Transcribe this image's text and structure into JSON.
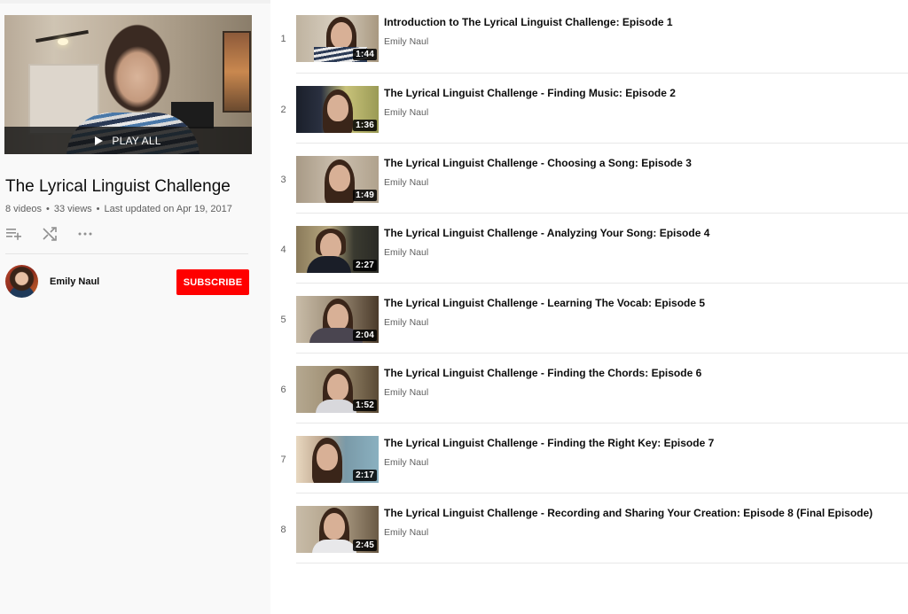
{
  "playlist": {
    "play_all_label": "PLAY ALL",
    "title": "The Lyrical Linguist Challenge",
    "stats": {
      "videos": "8 videos",
      "views": "33 views",
      "updated": "Last updated on Apr 19, 2017"
    },
    "separator": "•",
    "actions": [
      {
        "icon": "add-to-queue-icon",
        "label": "Save"
      },
      {
        "icon": "shuffle-icon",
        "label": "Shuffle"
      },
      {
        "icon": "more-icon",
        "label": "More actions"
      }
    ],
    "owner": {
      "name": "Emily Naul",
      "subscribe_label": "SUBSCRIBE"
    }
  },
  "colors": {
    "subscribe": "#ff0000",
    "sidebar_bg": "#f9f9f9",
    "secondary_text": "#606060"
  },
  "videos": [
    {
      "index": "1",
      "title": "Introduction to The Lyrical Linguist Challenge: Episode 1",
      "channel": "Emily Naul",
      "duration": "1:44"
    },
    {
      "index": "2",
      "title": "The Lyrical Linguist Challenge - Finding Music: Episode 2",
      "channel": "Emily Naul",
      "duration": "1:36"
    },
    {
      "index": "3",
      "title": "The Lyrical Linguist Challenge - Choosing a Song: Episode 3",
      "channel": "Emily Naul",
      "duration": "1:49"
    },
    {
      "index": "4",
      "title": "The Lyrical Linguist Challenge - Analyzing Your Song: Episode 4",
      "channel": "Emily Naul",
      "duration": "2:27"
    },
    {
      "index": "5",
      "title": "The Lyrical Linguist Challenge - Learning The Vocab: Episode 5",
      "channel": "Emily Naul",
      "duration": "2:04"
    },
    {
      "index": "6",
      "title": "The Lyrical Linguist Challenge - Finding the Chords: Episode 6",
      "channel": "Emily Naul",
      "duration": "1:52"
    },
    {
      "index": "7",
      "title": "The Lyrical Linguist Challenge - Finding the Right Key: Episode 7",
      "channel": "Emily Naul",
      "duration": "2:17"
    },
    {
      "index": "8",
      "title": "The Lyrical Linguist Challenge - Recording and Sharing Your Creation: Episode 8 (Final Episode)",
      "channel": "Emily Naul",
      "duration": "2:45"
    }
  ]
}
